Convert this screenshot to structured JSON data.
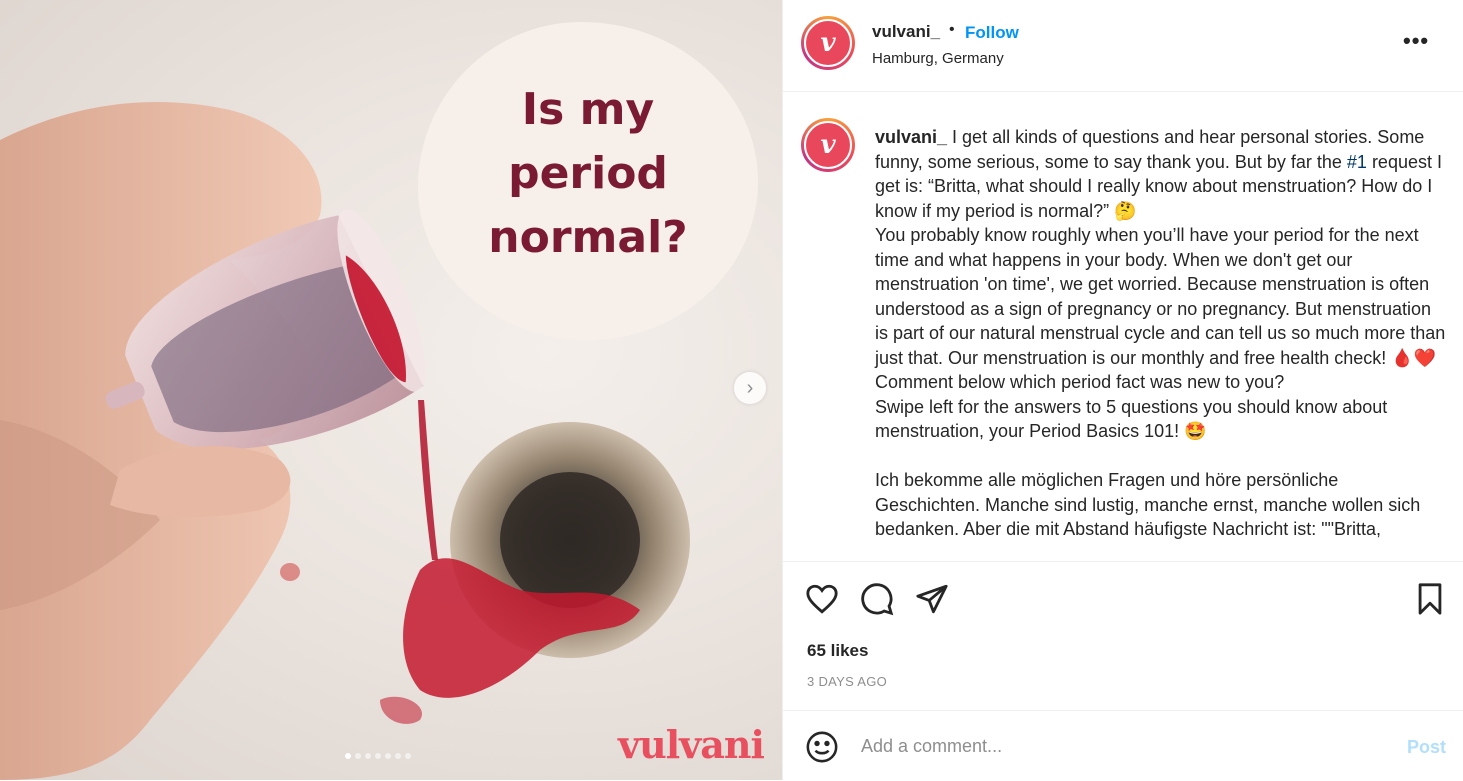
{
  "media": {
    "overlay_text": "Is my period normal?",
    "brand": "vulvani",
    "carousel": {
      "total_slides": 7,
      "active_index": 0
    },
    "icons": {
      "next": "chevron-right-icon"
    }
  },
  "post_header": {
    "username": "vulvani_",
    "separator": "•",
    "follow_label": "Follow",
    "location": "Hamburg, Germany",
    "avatar_letter": "v",
    "more_label": "•••"
  },
  "caption": {
    "username": "vulvani_",
    "text_before_hashtag": " I get all kinds of questions and hear personal stories. Some funny, some serious, some to say thank you. But by far the ",
    "hashtag": "#1",
    "text_after_hashtag": " request I get is: “Britta, what should I really know about menstruation? How do I know if my period is normal?” 🤔\nYou probably know roughly when you’ll have your period for the next time and what happens in your body. When we don't get our menstruation 'on time', we get worried. Because menstruation is often understood as a sign of pregnancy or no pregnancy. But menstruation is part of our natural menstrual cycle and can tell us so much more than just that. Our menstruation is our monthly and free health check! 🩸❤️\nComment below which period fact was new to you?\nSwipe left for the answers to 5 questions you should know about menstruation, your Period Basics 101! 🤩\n\nIch bekomme alle möglichen Fragen und höre persönliche Geschichten. Manche sind lustig, manche ernst, manche wollen sich bedanken. Aber die mit Abstand häufigste Nachricht ist: \"\"Britta,"
  },
  "actions": {
    "icons": [
      "heart-icon",
      "comment-icon",
      "share-icon",
      "bookmark-icon"
    ],
    "likes": "65 likes",
    "timestamp": "3 DAYS AGO"
  },
  "comment": {
    "placeholder": "Add a comment...",
    "post_label": "Post",
    "emoji_icon": "emoji-icon"
  },
  "colors": {
    "accent_blue": "#0095f6",
    "brand_red": "#e85060",
    "overlay_text": "#7a1b33",
    "post_disabled": "#b2dffc"
  }
}
